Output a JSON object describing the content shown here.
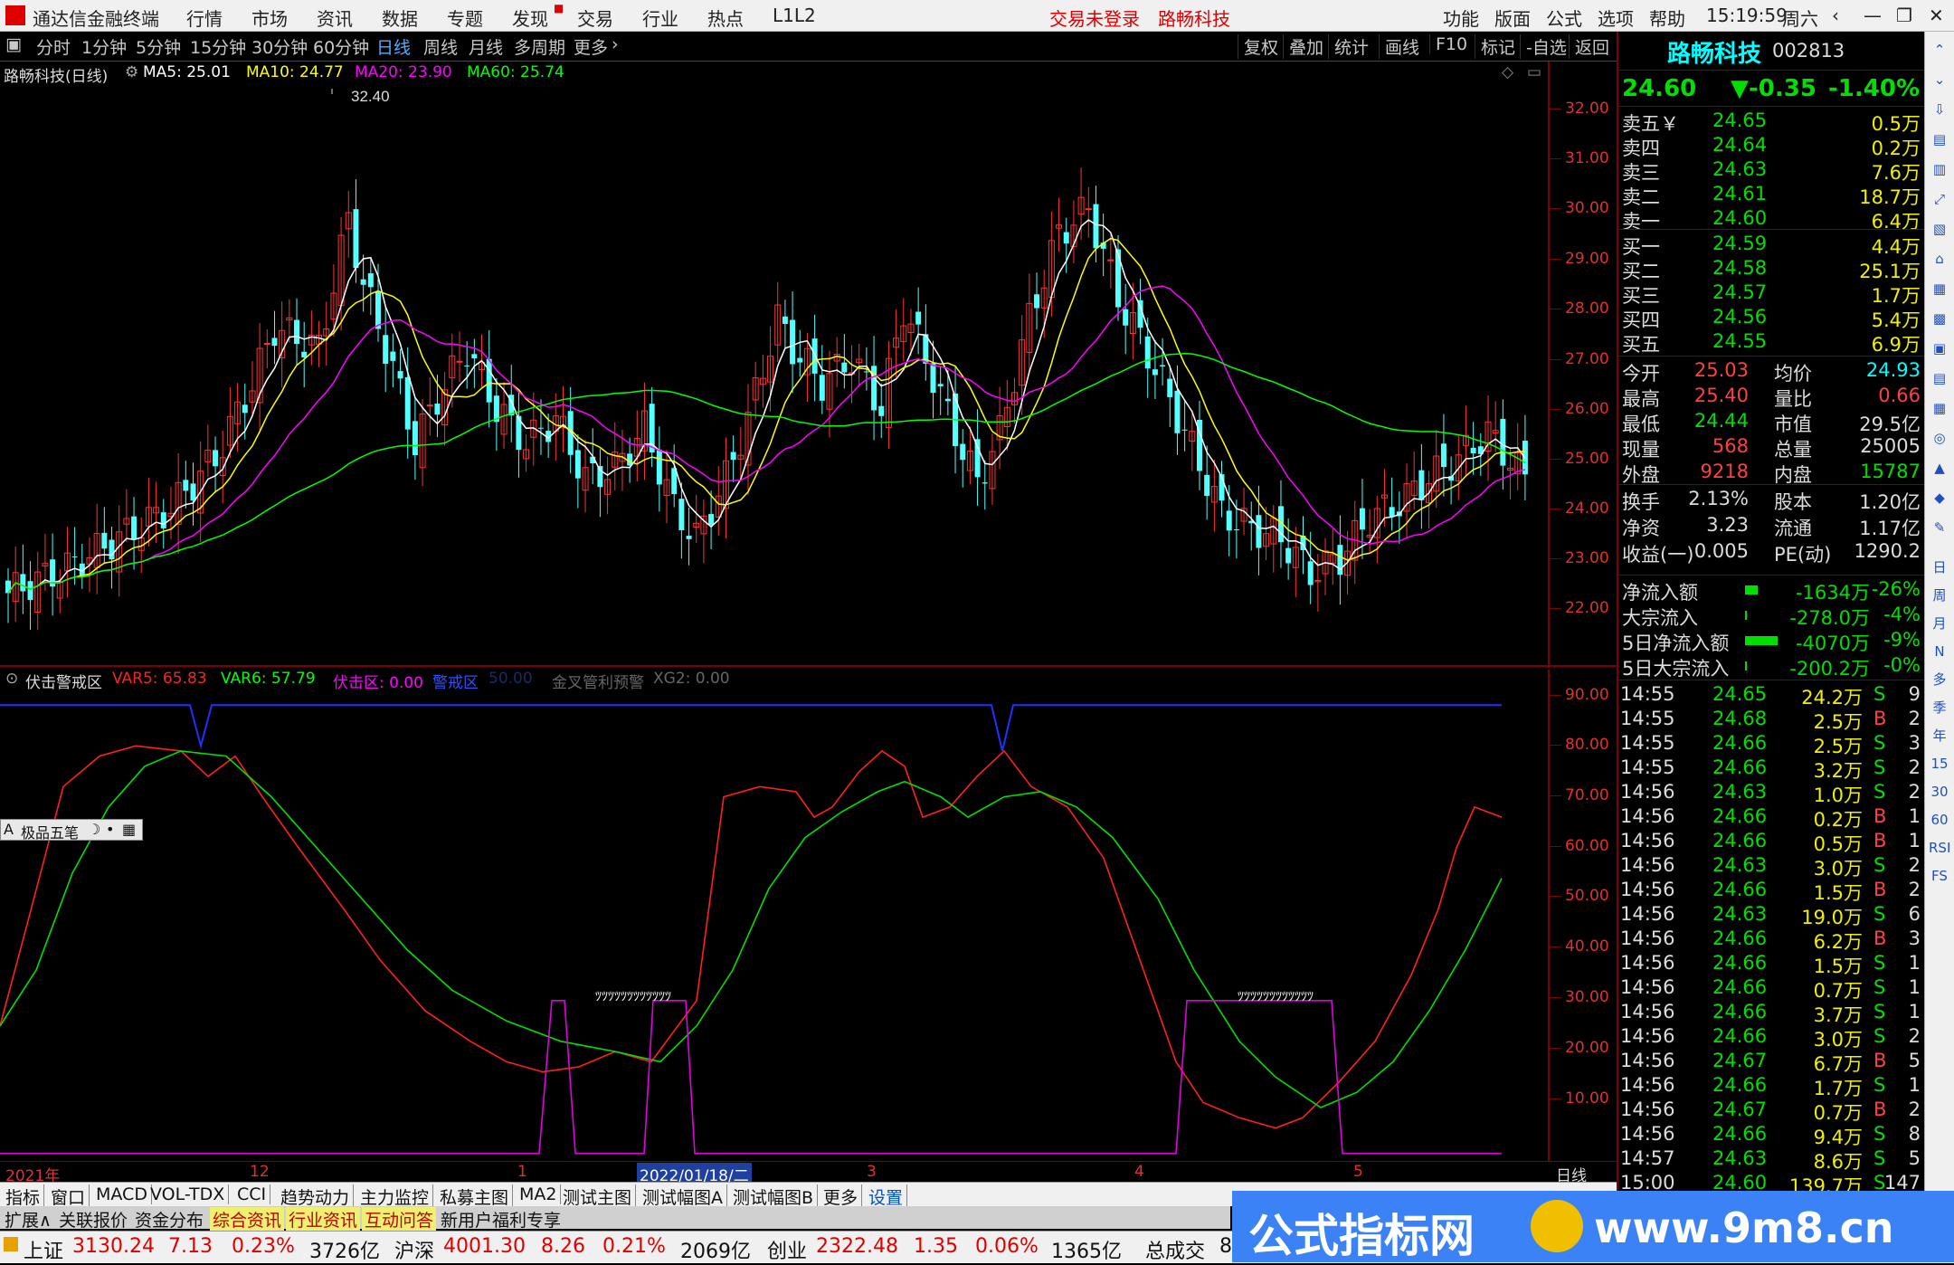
{
  "title_bar": {
    "app_name": "通达信金融终端",
    "menus": [
      "行情",
      "市场",
      "资讯",
      "数据",
      "专题",
      "发现",
      "交易",
      "行业",
      "热点",
      "L1L2"
    ],
    "status_login": "交易未登录",
    "stock_name": "路畅科技",
    "right_menus": [
      "功能",
      "版面",
      "公式",
      "选项",
      "帮助"
    ],
    "time": "15:19:59",
    "weekday": "周六"
  },
  "toolbar": {
    "periods": [
      "分时",
      "1分钟",
      "5分钟",
      "15分钟",
      "30分钟",
      "60分钟",
      "日线",
      "周线",
      "月线",
      "多周期",
      "更多"
    ],
    "active": "日线",
    "right": [
      "复权",
      "叠加",
      "统计",
      "画线",
      "F10",
      "标记",
      "-自选",
      "返回"
    ]
  },
  "main_chart": {
    "legend_title": "路畅科技(日线)",
    "ma5": "MA5: 25.01",
    "ma10": "MA10: 24.77",
    "ma20": "MA20: 23.90",
    "ma60": "MA60: 25.74",
    "max_label": "32.40",
    "yaxis": [
      "32.00",
      "31.00",
      "30.00",
      "29.00",
      "28.00",
      "27.00",
      "26.00",
      "25.00",
      "24.00",
      "23.00",
      "22.00"
    ],
    "colors": {
      "ma5": "#ffffff",
      "ma10": "#ffff00",
      "ma20": "#ff00ff",
      "ma60": "#00ff00",
      "up": "#ff3232",
      "down": "#54ffff"
    }
  },
  "indicator": {
    "name": "伏击警戒区",
    "var5": "VAR5: 65.83",
    "var6": "VAR6: 57.79",
    "zone": "伏击区: 0.00",
    "alert": "警戒区",
    "extra_a": "50.00",
    "extra_b": "金叉管利预警",
    "extra_c": "XG2: 0.00",
    "yaxis": [
      "90.00",
      "80.00",
      "70.00",
      "60.00",
      "50.00",
      "40.00",
      "30.00",
      "20.00",
      "10.00"
    ],
    "marker_text": "ﾂﾂﾂﾂﾂﾂﾂﾂﾂﾂﾂﾂ",
    "popup_label": "极品五笔"
  },
  "xaxis": {
    "labels": [
      "2021年",
      "12",
      "1",
      "2022/01/18/二",
      "3",
      "4",
      "5"
    ],
    "period": "日线"
  },
  "quote": {
    "name": "路畅科技",
    "code": "002813",
    "price": "24.60",
    "change": "▼-0.35",
    "pct": "-1.40%",
    "asks": [
      {
        "label": "卖五￥",
        "price": "24.65",
        "vol": "0.5万"
      },
      {
        "label": "卖四",
        "price": "24.64",
        "vol": "0.2万"
      },
      {
        "label": "卖三",
        "price": "24.63",
        "vol": "7.6万"
      },
      {
        "label": "卖二",
        "price": "24.61",
        "vol": "18.7万"
      },
      {
        "label": "卖一",
        "price": "24.60",
        "vol": "6.4万"
      }
    ],
    "bids": [
      {
        "label": "买一",
        "price": "24.59",
        "vol": "4.4万"
      },
      {
        "label": "买二",
        "price": "24.58",
        "vol": "25.1万"
      },
      {
        "label": "买三",
        "price": "24.57",
        "vol": "1.7万"
      },
      {
        "label": "买四",
        "price": "24.56",
        "vol": "5.4万"
      },
      {
        "label": "买五",
        "price": "24.55",
        "vol": "6.9万"
      }
    ],
    "stats": [
      {
        "k1": "今开",
        "v1": "25.03",
        "k2": "均价",
        "v2": "24.93"
      },
      {
        "k1": "最高",
        "v1": "25.40",
        "k2": "量比",
        "v2": "0.66"
      },
      {
        "k1": "最低",
        "v1": "24.44",
        "k2": "市值",
        "v2": "29.5亿"
      },
      {
        "k1": "现量",
        "v1": "568",
        "k2": "总量",
        "v2": "25005"
      },
      {
        "k1": "外盘",
        "v1": "9218",
        "k2": "内盘",
        "v2": "15787"
      }
    ],
    "stats2": [
      {
        "k1": "换手",
        "v1": "2.13%",
        "k2": "股本",
        "v2": "1.20亿"
      },
      {
        "k1": "净资",
        "v1": "3.23",
        "k2": "流通",
        "v2": "1.17亿"
      },
      {
        "k1": "收益(一)",
        "v1": "0.005",
        "k2": "PE(动)",
        "v2": "1290.2"
      }
    ],
    "flows": [
      {
        "k": "净流入额",
        "v": "-1634万",
        "p": "-26%"
      },
      {
        "k": "大宗流入",
        "v": "-278.0万",
        "p": "-4%"
      },
      {
        "k": "5日净流入额",
        "v": "-4070万",
        "p": "-9%"
      },
      {
        "k": "5日大宗流入",
        "v": "-200.2万",
        "p": "-0%"
      }
    ],
    "ticks": [
      {
        "t": "14:55",
        "p": "24.65",
        "v": "24.2万",
        "s": "S",
        "n": "9"
      },
      {
        "t": "14:55",
        "p": "24.68",
        "v": "2.5万",
        "s": "B",
        "n": "2"
      },
      {
        "t": "14:55",
        "p": "24.66",
        "v": "2.5万",
        "s": "S",
        "n": "3"
      },
      {
        "t": "14:55",
        "p": "24.66",
        "v": "3.2万",
        "s": "S",
        "n": "2"
      },
      {
        "t": "14:56",
        "p": "24.63",
        "v": "1.0万",
        "s": "S",
        "n": "2"
      },
      {
        "t": "14:56",
        "p": "24.66",
        "v": "0.2万",
        "s": "B",
        "n": "1"
      },
      {
        "t": "14:56",
        "p": "24.66",
        "v": "0.5万",
        "s": "B",
        "n": "1"
      },
      {
        "t": "14:56",
        "p": "24.63",
        "v": "3.0万",
        "s": "S",
        "n": "2"
      },
      {
        "t": "14:56",
        "p": "24.66",
        "v": "1.5万",
        "s": "B",
        "n": "2"
      },
      {
        "t": "14:56",
        "p": "24.63",
        "v": "19.0万",
        "s": "S",
        "n": "6"
      },
      {
        "t": "14:56",
        "p": "24.66",
        "v": "6.2万",
        "s": "B",
        "n": "3"
      },
      {
        "t": "14:56",
        "p": "24.66",
        "v": "1.5万",
        "s": "S",
        "n": "1"
      },
      {
        "t": "14:56",
        "p": "24.66",
        "v": "0.7万",
        "s": "S",
        "n": "1"
      },
      {
        "t": "14:56",
        "p": "24.66",
        "v": "3.7万",
        "s": "S",
        "n": "1"
      },
      {
        "t": "14:56",
        "p": "24.66",
        "v": "3.0万",
        "s": "S",
        "n": "2"
      },
      {
        "t": "14:56",
        "p": "24.67",
        "v": "6.7万",
        "s": "B",
        "n": "5"
      },
      {
        "t": "14:56",
        "p": "24.66",
        "v": "1.7万",
        "s": "S",
        "n": "1"
      },
      {
        "t": "14:56",
        "p": "24.67",
        "v": "0.7万",
        "s": "B",
        "n": "2"
      },
      {
        "t": "14:56",
        "p": "24.66",
        "v": "9.4万",
        "s": "S",
        "n": "8"
      },
      {
        "t": "14:57",
        "p": "24.63",
        "v": "8.6万",
        "s": "S",
        "n": "5"
      },
      {
        "t": "15:00",
        "p": "24.60",
        "v": "139.7万",
        "s": "S",
        "n": "147"
      }
    ]
  },
  "side_icons": [
    "日",
    "周",
    "月",
    "N",
    "多",
    "季",
    "年",
    "15",
    "30",
    "60",
    "RSI",
    "FS"
  ],
  "tabs1": [
    "指标",
    "窗口",
    "MACD",
    "VOL-TDX",
    "CCI",
    "趋势动力",
    "主力监控",
    "私募主图",
    "MA2",
    "测试主图",
    "测试幅图A",
    "测试幅图B",
    "更多",
    "设置"
  ],
  "tabs2": [
    "扩展∧",
    "关联报价",
    "资金分布",
    "综合资讯",
    "行业资讯",
    "互动问答",
    "新用户福利专享"
  ],
  "status": {
    "idx1_name": "上证",
    "idx1_val": "3130.24",
    "idx1_chg": "7.13",
    "idx1_pct": "0.23%",
    "idx1_amt": "3726亿",
    "idx2_name": "沪深",
    "idx2_val": "4001.30",
    "idx2_chg": "8.26",
    "idx2_pct": "0.21%",
    "idx2_amt": "2069亿",
    "idx3_name": "创业",
    "idx3_val": "2322.48",
    "idx3_chg": "1.35",
    "idx3_pct": "0.06%",
    "idx3_amt": "1365亿",
    "total_label": "总成交",
    "total_val": "8"
  },
  "banner": {
    "text": "公式指标网",
    "url": "www.9m8.cn"
  }
}
